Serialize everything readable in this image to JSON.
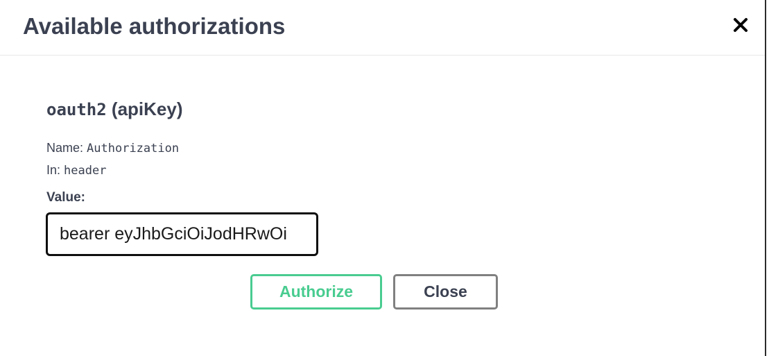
{
  "modal": {
    "title": "Available authorizations",
    "close_icon": "close-x-icon"
  },
  "scheme": {
    "name_code": "oauth2",
    "name_suffix": " (apiKey)",
    "name_label": "Name: ",
    "name_value": "Authorization",
    "in_label": "In: ",
    "in_value": "header",
    "value_label": "Value:",
    "value_input": "bearer eyJhbGciOiJodHRwOi"
  },
  "buttons": {
    "authorize_label": "Authorize",
    "close_label": "Close"
  },
  "colors": {
    "text": "#3b4151",
    "authorize_green": "#49cc90",
    "close_gray": "#808080",
    "input_border": "#0f0f0f"
  }
}
